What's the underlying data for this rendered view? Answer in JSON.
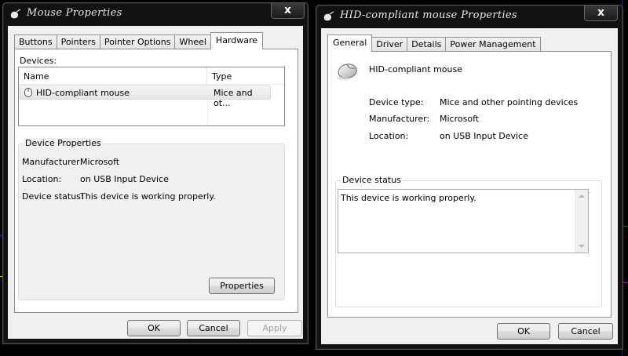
{
  "left_window": {
    "title": "Mouse Properties",
    "close_label": "x",
    "tabs": [
      {
        "label": "Buttons"
      },
      {
        "label": "Pointers"
      },
      {
        "label": "Pointer Options"
      },
      {
        "label": "Wheel"
      },
      {
        "label": "Hardware",
        "active": true
      }
    ],
    "devices_label": "Devices:",
    "columns": {
      "name": "Name",
      "type": "Type"
    },
    "rows": [
      {
        "name": "HID-compliant mouse",
        "type": "Mice and ot..."
      }
    ],
    "group_title": "Device Properties",
    "properties": [
      {
        "label": "Manufacturer:",
        "value": "Microsoft"
      },
      {
        "label": "Location:",
        "value": "on USB Input Device"
      },
      {
        "label": "Device status:",
        "value": "This device is working properly."
      }
    ],
    "properties_button": "Properties",
    "buttons": {
      "ok": "OK",
      "cancel": "Cancel",
      "apply": "Apply"
    }
  },
  "right_window": {
    "title": "HID-compliant mouse Properties",
    "close_label": "x",
    "tabs": [
      {
        "label": "General",
        "active": true
      },
      {
        "label": "Driver"
      },
      {
        "label": "Details"
      },
      {
        "label": "Power Management"
      }
    ],
    "device_name": "HID-compliant mouse",
    "properties": [
      {
        "label": "Device type:",
        "value": "Mice and other pointing devices"
      },
      {
        "label": "Manufacturer:",
        "value": "Microsoft"
      },
      {
        "label": "Location:",
        "value": "on USB Input Device"
      }
    ],
    "status_title": "Device status",
    "status_text": "This device is working properly.",
    "buttons": {
      "ok": "OK",
      "cancel": "Cancel"
    }
  }
}
